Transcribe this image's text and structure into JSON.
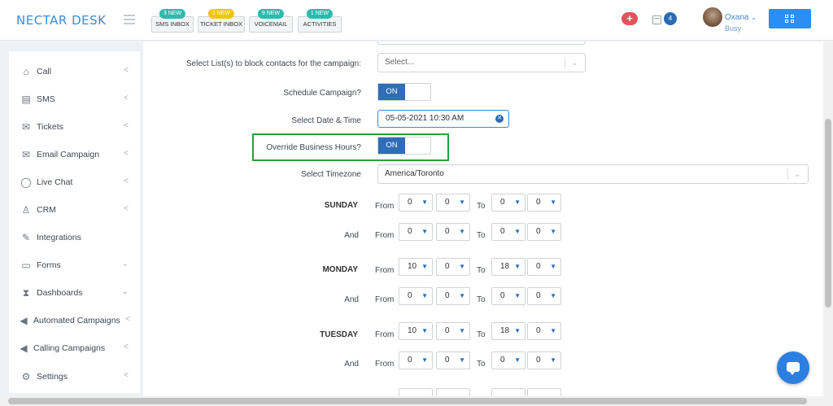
{
  "app": {
    "logo": "NECTAR DESK"
  },
  "topbar": {
    "inboxes": [
      {
        "label": "SMS INBOX",
        "badge": "3 NEW",
        "badge_color": "#2bbbad"
      },
      {
        "label": "TICKET INBOX",
        "badge": "2 NEW",
        "badge_color": "#f1c40f"
      },
      {
        "label": "VOICEMAIL",
        "badge": "9 NEW",
        "badge_color": "#2bbbad"
      },
      {
        "label": "ACTIVITIES",
        "badge": "1 NEW",
        "badge_color": "#2bbbad"
      }
    ],
    "plus_icon": "+",
    "calendar_count": "4",
    "user": {
      "name": "Oxana",
      "status": "Busy"
    }
  },
  "sidebar": {
    "items": [
      {
        "label": "Call",
        "icon": "home-icon",
        "arrow": "<"
      },
      {
        "label": "SMS",
        "icon": "sms-icon",
        "arrow": "<"
      },
      {
        "label": "Tickets",
        "icon": "envelope-icon",
        "arrow": "<"
      },
      {
        "label": "Email Campaign",
        "icon": "envelope-icon",
        "arrow": "<"
      },
      {
        "label": "Live Chat",
        "icon": "chat-icon",
        "arrow": "<"
      },
      {
        "label": "CRM",
        "icon": "user-icon",
        "arrow": "<"
      },
      {
        "label": "Integrations",
        "icon": "integrations-icon",
        "arrow": ""
      },
      {
        "label": "Forms",
        "icon": "folder-icon",
        "arrow": "v"
      },
      {
        "label": "Dashboards",
        "icon": "hourglass-icon",
        "arrow": "v"
      },
      {
        "label": "Automated Campaigns",
        "icon": "megaphone-icon",
        "arrow": "<"
      },
      {
        "label": "Calling Campaigns",
        "icon": "megaphone-icon",
        "arrow": "<"
      },
      {
        "label": "Settings",
        "icon": "gear-icon",
        "arrow": "<"
      }
    ]
  },
  "form": {
    "block_list_label": "Select List(s) to block contacts for the campaign:",
    "block_list_placeholder": "Select...",
    "schedule_label": "Schedule Campaign?",
    "schedule_toggle": "ON",
    "date_label": "Select Date & Time",
    "date_value": "05-05-2021 10:30 AM",
    "override_label": "Override Business Hours?",
    "override_toggle": "ON",
    "timezone_label": "Select Timezone",
    "timezone_value": "America/Toronto",
    "from_label": "From",
    "to_label": "To",
    "and_label": "And",
    "schedule": [
      {
        "day": "SUNDAY",
        "rows": [
          {
            "from": [
              "0",
              "0"
            ],
            "to": [
              "0",
              "0"
            ]
          },
          {
            "from": [
              "0",
              "0"
            ],
            "to": [
              "0",
              "0"
            ]
          }
        ]
      },
      {
        "day": "MONDAY",
        "rows": [
          {
            "from": [
              "10",
              "0"
            ],
            "to": [
              "18",
              "0"
            ]
          },
          {
            "from": [
              "0",
              "0"
            ],
            "to": [
              "0",
              "0"
            ]
          }
        ]
      },
      {
        "day": "TUESDAY",
        "rows": [
          {
            "from": [
              "10",
              "0"
            ],
            "to": [
              "18",
              "0"
            ]
          },
          {
            "from": [
              "0",
              "0"
            ],
            "to": [
              "0",
              "0"
            ]
          }
        ]
      }
    ]
  }
}
